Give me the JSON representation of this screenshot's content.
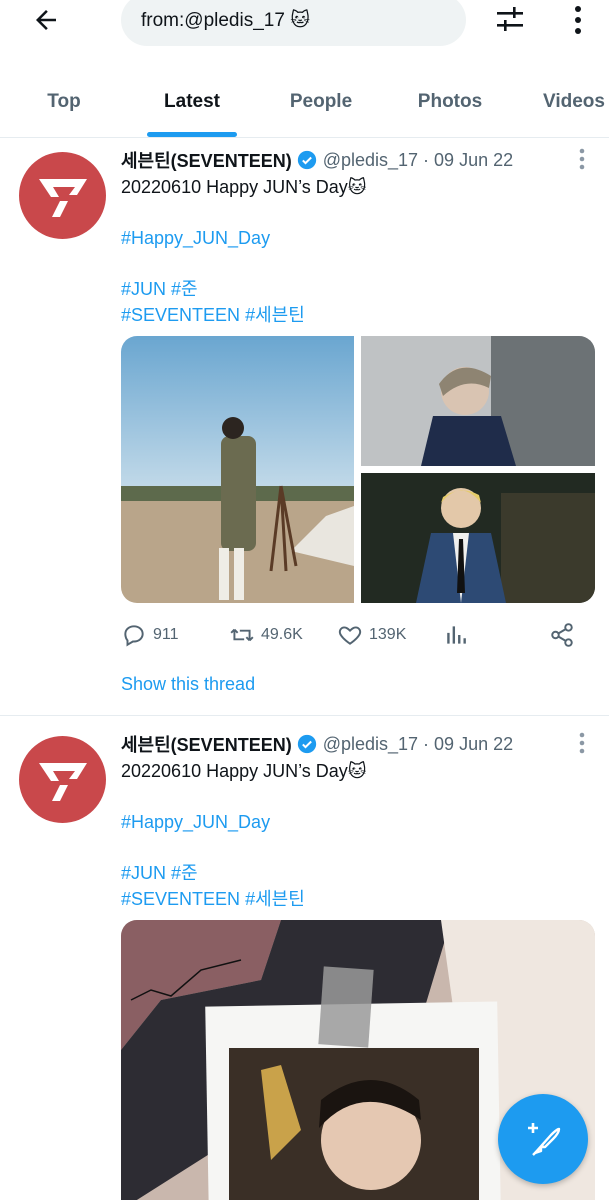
{
  "search": {
    "query": "from:@pledis_17 🐱"
  },
  "tabs": [
    "Top",
    "Latest",
    "People",
    "Photos",
    "Videos"
  ],
  "active_tab": "Latest",
  "tweets": [
    {
      "name": "세븐틴(SEVENTEEN)",
      "handle": "@pledis_17",
      "separator": "·",
      "date": "09 Jun 22",
      "text_line1": "20220610 Happy JUN’s Day🐱",
      "hashtag_line2": "#Happy_JUN_Day",
      "hashtag_line3a": "#JUN",
      "hashtag_line3b": "#준",
      "hashtag_line4a": "#SEVENTEEN",
      "hashtag_line4b": "#세븐틴",
      "replies": "911",
      "retweets": "49.6K",
      "likes": "139K",
      "show_thread": "Show this thread"
    },
    {
      "name": "세븐틴(SEVENTEEN)",
      "handle": "@pledis_17",
      "separator": "·",
      "date": "09 Jun 22",
      "text_line1": "20220610 Happy JUN’s Day🐱",
      "hashtag_line2": "#Happy_JUN_Day",
      "hashtag_line3a": "#JUN",
      "hashtag_line3b": "#준",
      "hashtag_line4a": "#SEVENTEEN",
      "hashtag_line4b": "#세븐틴"
    }
  ],
  "colors": {
    "accent": "#1d9bf0",
    "avatar_bg": "#c9484b",
    "muted": "#536471"
  },
  "icons": [
    "back-arrow-icon",
    "filter-sliders-icon",
    "more-vertical-icon",
    "seventeen-logo-icon",
    "verified-badge-icon",
    "reply-icon",
    "retweet-icon",
    "like-icon",
    "analytics-icon",
    "share-icon",
    "compose-feather-icon"
  ]
}
